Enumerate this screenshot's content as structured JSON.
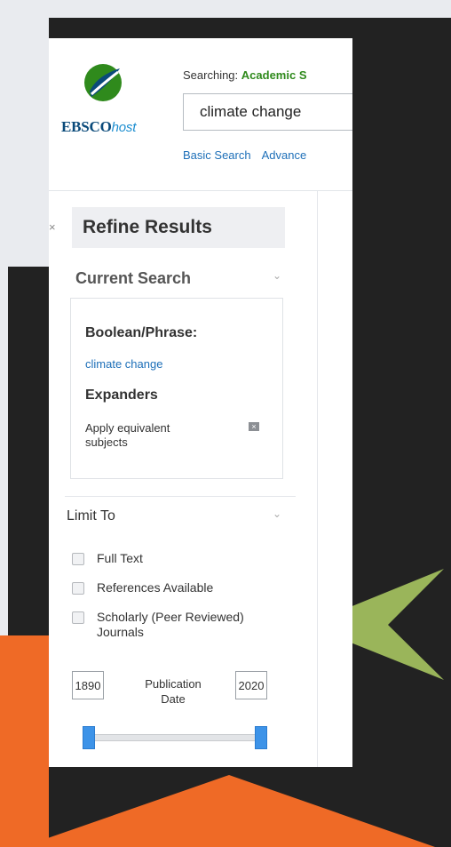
{
  "brand": {
    "name": "EBSCO",
    "suffix": "host",
    "colors": {
      "green": "#2f8a1c",
      "blue": "#1d8ed0",
      "navy": "#0a4a7a"
    }
  },
  "header": {
    "searching_label": "Searching:",
    "database": "Academic S",
    "search_value": "climate change",
    "links": [
      "Basic Search",
      "Advance"
    ]
  },
  "sidebar": {
    "collapse_icon": "close-icon",
    "refine_title": "Refine Results",
    "current_search": {
      "title": "Current Search",
      "boolean_label": "Boolean/Phrase:",
      "boolean_value": "climate change",
      "expanders_label": "Expanders",
      "expander_item": "Apply equivalent subjects"
    },
    "limit_to": {
      "title": "Limit To",
      "options": [
        {
          "label": "Full Text",
          "checked": false
        },
        {
          "label": "References Available",
          "checked": false
        },
        {
          "label": "Scholarly (Peer Reviewed)",
          "label2": "Journals",
          "checked": false
        }
      ],
      "date_from": "1890",
      "date_to": "2020",
      "date_label_line1": "Publication",
      "date_label_line2": "Date"
    }
  },
  "background": {
    "dark": "#222222",
    "light": "#e9ebef",
    "orange": "#ef6a26",
    "arrow": "#9ab55a"
  }
}
